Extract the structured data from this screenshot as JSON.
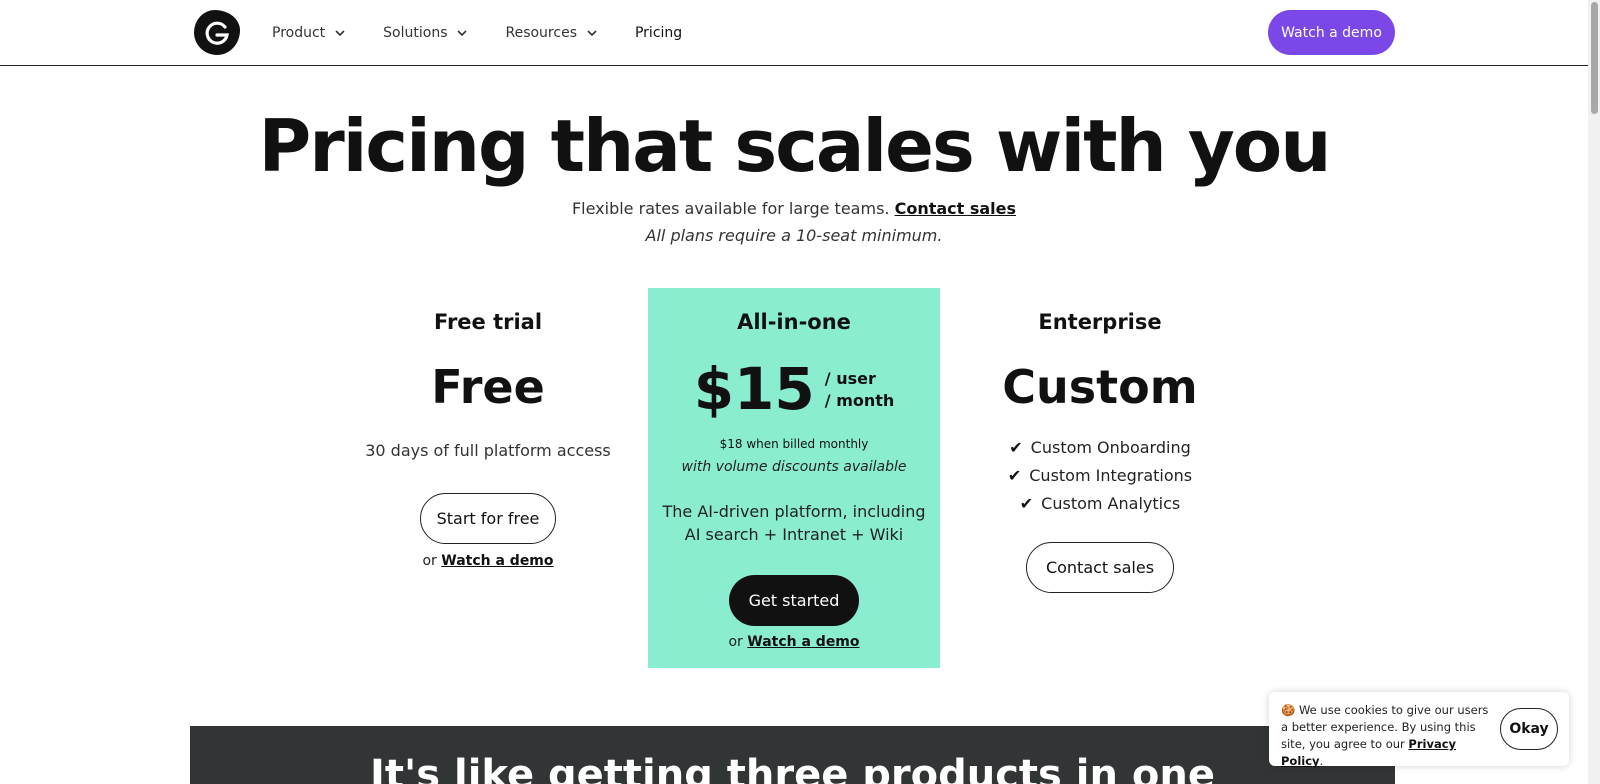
{
  "header": {
    "nav": [
      {
        "label": "Product",
        "has_dropdown": true
      },
      {
        "label": "Solutions",
        "has_dropdown": true
      },
      {
        "label": "Resources",
        "has_dropdown": true
      },
      {
        "label": "Pricing",
        "has_dropdown": false
      }
    ],
    "cta_label": "Watch a demo",
    "cta_color": "#7b47e6"
  },
  "hero": {
    "title": "Pricing that scales with you",
    "subtitle": "Flexible rates available for large teams.",
    "subtitle_link": "Contact sales",
    "note": "All plans require a 10-seat minimum."
  },
  "plans": {
    "free": {
      "name": "Free trial",
      "price": "Free",
      "description": "30 days of full platform access",
      "button": "Start for free",
      "or_text": "or",
      "or_link": "Watch a demo"
    },
    "aio": {
      "name": "All-in-one",
      "price": "$15",
      "per_user": "/ user",
      "per_month": "/ month",
      "monthly_note": "$18 when billed monthly",
      "volume_note": "with volume discounts available",
      "desc_line1": "The AI-driven platform, including",
      "desc_line2": "AI search + Intranet + Wiki",
      "button": "Get started",
      "or_text": "or",
      "or_link": "Watch a demo",
      "bg_color": "#8aedd0"
    },
    "enterprise": {
      "name": "Enterprise",
      "price": "Custom",
      "features": [
        "Custom Onboarding",
        "Custom Integrations",
        "Custom Analytics"
      ],
      "check_glyph": "✔",
      "button": "Contact sales"
    }
  },
  "band": {
    "title": "It's like getting three products in one"
  },
  "cookie": {
    "emoji": "🍪",
    "text": "We use cookies to give our users a better experience.  By using this site, you agree to our",
    "link": "Privacy Policy",
    "end": ".",
    "button": "Okay"
  }
}
